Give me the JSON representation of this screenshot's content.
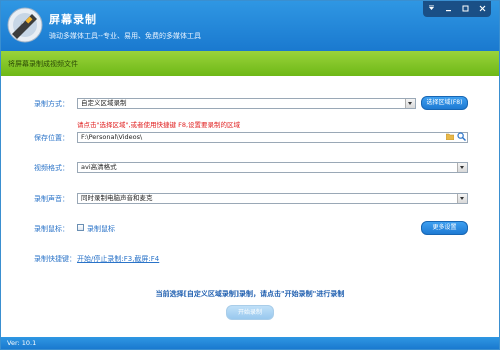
{
  "window": {
    "title": "屏幕录制",
    "subtitle": "骑动多媒体工具--专业、易用、免费的多媒体工具"
  },
  "section": {
    "label": "将屏幕录制成视频文件"
  },
  "form": {
    "record_mode": {
      "label": "录制方式：",
      "value": "自定义区域录制",
      "button": "选择区域(F8)"
    },
    "hint": "请点击\"选择区域\",或者使用快捷键 F8,设置要录制的区域",
    "save_location": {
      "label": "保存位置：",
      "value": "F:\\Personal\\Videos\\"
    },
    "video_format": {
      "label": "视频格式：",
      "value": "avi高清格式"
    },
    "audio": {
      "label": "录制声音：",
      "value": "同时录制电脑声音和麦克"
    },
    "cursor": {
      "label": "录制鼠标：",
      "checkbox_label": "录制鼠标",
      "more_button": "更多设置"
    },
    "hotkey": {
      "label": "录制快捷键：",
      "value": "开始/停止录制:F3,截屏:F4"
    }
  },
  "status_message": "当前选择[自定义区域录制]录制，请点击\"开始录制\"进行录制",
  "start_button": "开始录制",
  "version": "Ver: 10.1",
  "colors": {
    "header_blue": "#1a79cf",
    "green_bar": "#6eb817",
    "label_blue": "#2a73c8",
    "hint_red": "#e02020"
  }
}
